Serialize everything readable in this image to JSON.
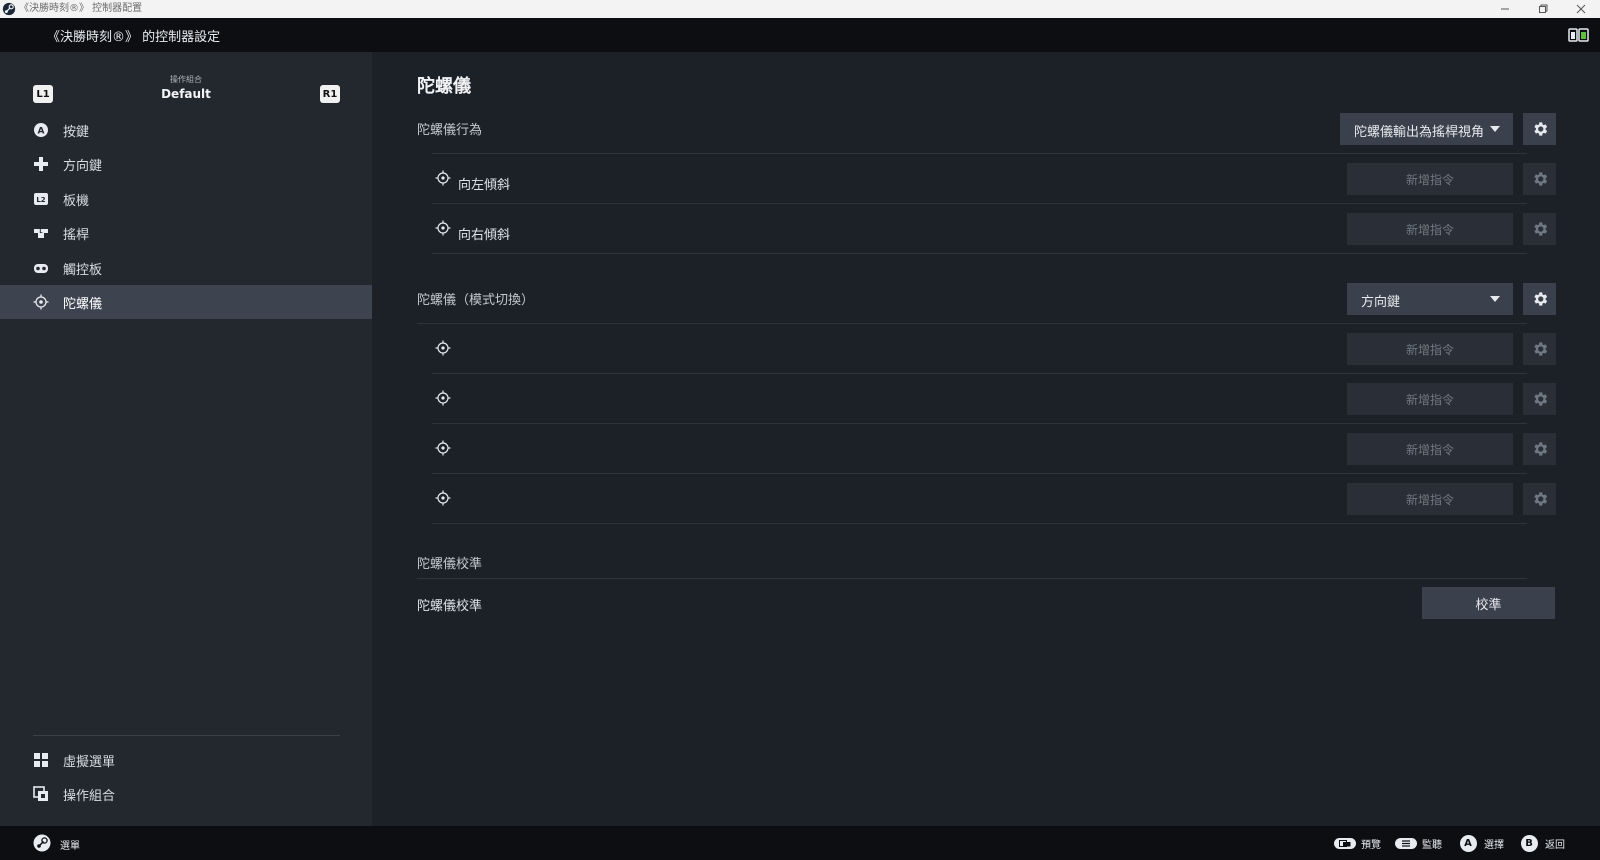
{
  "window": {
    "title": "《決勝時刻®》 控制器配置"
  },
  "header": {
    "title": "《決勝時刻®》 的控制器設定"
  },
  "sidebar": {
    "action_set_label": "操作組合",
    "action_set_name": "Default",
    "bumper_left": "L1",
    "bumper_right": "R1",
    "items": [
      {
        "label": "按鍵",
        "icon": "a-button-icon"
      },
      {
        "label": "方向鍵",
        "icon": "dpad-icon"
      },
      {
        "label": "板機",
        "icon": "l2-trigger-icon"
      },
      {
        "label": "搖桿",
        "icon": "joystick-icon"
      },
      {
        "label": "觸控板",
        "icon": "trackpad-icon"
      },
      {
        "label": "陀螺儀",
        "icon": "gyro-icon",
        "active": true
      }
    ],
    "bottom_items": [
      {
        "label": "虛擬選單",
        "icon": "grid-menu-icon"
      },
      {
        "label": "操作組合",
        "icon": "action-sets-icon"
      }
    ]
  },
  "main": {
    "title": "陀螺儀",
    "behavior": {
      "label": "陀螺儀行為",
      "dropdown_value": "陀螺儀輸出為搖桿視角",
      "rows": [
        {
          "label": "向左傾斜",
          "button": "新增指令"
        },
        {
          "label": "向右傾斜",
          "button": "新增指令"
        }
      ]
    },
    "mode_shift": {
      "label": "陀螺儀（模式切換）",
      "dropdown_value": "方向鍵",
      "rows": [
        {
          "label": "",
          "button": "新增指令"
        },
        {
          "label": "",
          "button": "新增指令"
        },
        {
          "label": "",
          "button": "新增指令"
        },
        {
          "label": "",
          "button": "新增指令"
        }
      ]
    },
    "calibration": {
      "section_label": "陀螺儀校準",
      "row_label": "陀螺儀校準",
      "button": "校準"
    }
  },
  "footer": {
    "menu_label": "選單",
    "hints": [
      {
        "label": "預覽",
        "icon": "view-button-icon"
      },
      {
        "label": "監聽",
        "icon": "menu-button-icon"
      },
      {
        "label": "選擇",
        "icon": "a-button-icon",
        "glyph": "A"
      },
      {
        "label": "返回",
        "icon": "b-button-icon",
        "glyph": "B"
      }
    ]
  },
  "colors": {
    "sidebar_bg": "#23272e",
    "main_bg": "#1c2027",
    "active_item_bg": "#3d4450",
    "header_bg": "#0c0e12",
    "button_bg": "#3a414c",
    "disabled_button_bg": "#2a2f37"
  }
}
